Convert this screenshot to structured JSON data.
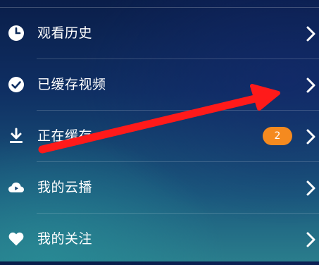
{
  "menu": {
    "items": [
      {
        "label": "观看历史",
        "icon": "clock-icon"
      },
      {
        "label": "已缓存视频",
        "icon": "check-circle-icon"
      },
      {
        "label": "正在缓存",
        "icon": "download-icon",
        "badge": "2"
      },
      {
        "label": "我的云播",
        "icon": "cloud-play-icon"
      },
      {
        "label": "我的关注",
        "icon": "heart-icon"
      }
    ]
  },
  "colors": {
    "badge": "#f58a1f",
    "annotation_arrow": "#ff1a1a",
    "text": "#ffffff"
  }
}
